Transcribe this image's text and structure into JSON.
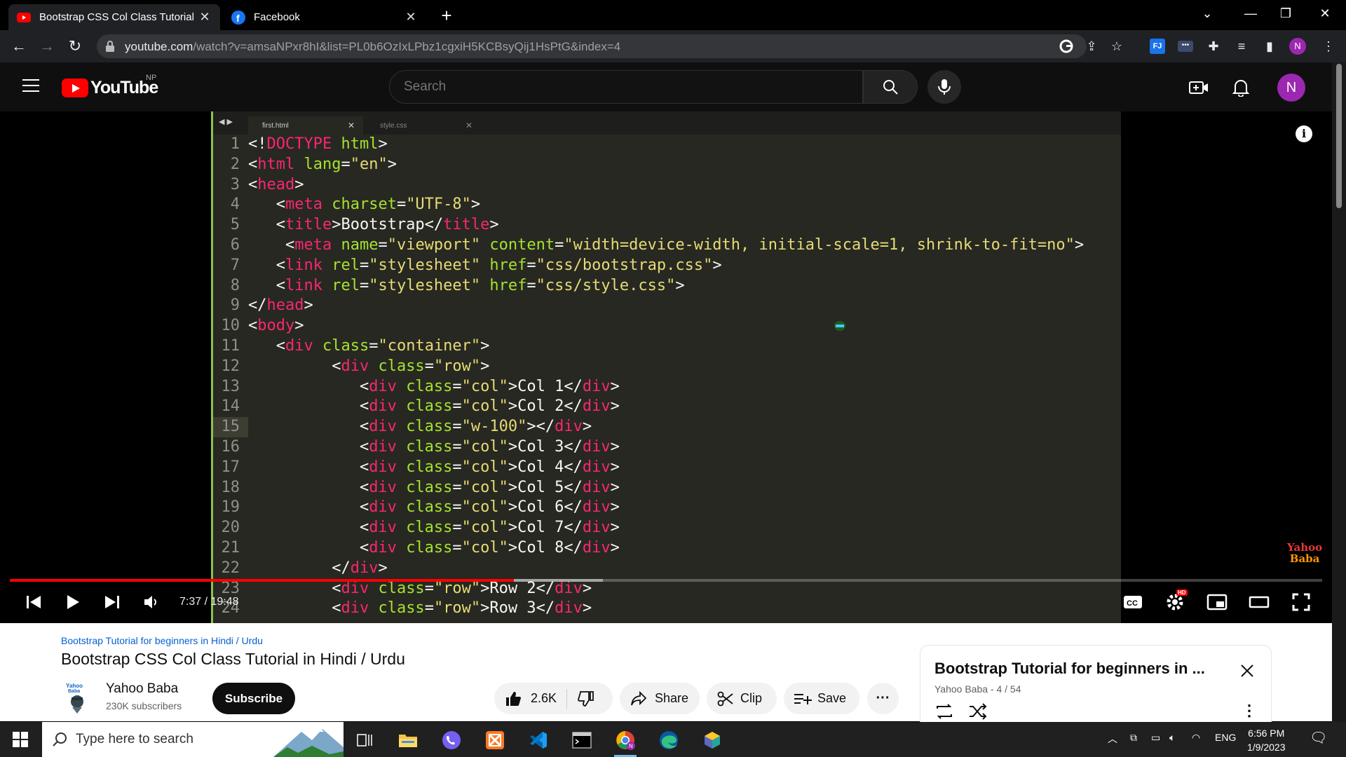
{
  "browser": {
    "tabs": [
      {
        "title": "Bootstrap CSS Col Class Tutorial i",
        "icon": "youtube-icon",
        "active": true
      },
      {
        "title": "Facebook",
        "icon": "facebook-icon",
        "active": false
      }
    ],
    "new_tab": "+",
    "url_host": "youtube.com",
    "url_path": "/watch?v=amsaNPxr8hI&list=PL0b6OzIxLPbz1cgxiH5KCBsyQij1HsPtG&index=4",
    "profile_initial": "N",
    "extension_label": "FJ"
  },
  "youtube": {
    "logo_text": "YouTube",
    "country_code": "NP",
    "search_placeholder": "Search",
    "avatar_initial": "N"
  },
  "editor": {
    "tabs": [
      "first.html",
      "style.css"
    ],
    "current_line": 15,
    "lines": [
      {
        "n": "1",
        "tokens": [
          [
            "p",
            "<!"
          ],
          [
            "t",
            "DOCTYPE"
          ],
          [
            "p",
            " "
          ],
          [
            "a",
            "html"
          ],
          [
            "p",
            ">"
          ]
        ]
      },
      {
        "n": "2",
        "tokens": [
          [
            "p",
            "<"
          ],
          [
            "t",
            "html"
          ],
          [
            "p",
            " "
          ],
          [
            "a",
            "lang"
          ],
          [
            "p",
            "="
          ],
          [
            "s",
            "\"en\""
          ],
          [
            "p",
            ">"
          ]
        ]
      },
      {
        "n": "3",
        "tokens": [
          [
            "p",
            "<"
          ],
          [
            "t",
            "head"
          ],
          [
            "p",
            ">"
          ]
        ]
      },
      {
        "n": "4",
        "tokens": [
          [
            "p",
            "   <"
          ],
          [
            "t",
            "meta"
          ],
          [
            "p",
            " "
          ],
          [
            "a",
            "charset"
          ],
          [
            "p",
            "="
          ],
          [
            "s",
            "\"UTF-8\""
          ],
          [
            "p",
            ">"
          ]
        ]
      },
      {
        "n": "5",
        "tokens": [
          [
            "p",
            "   <"
          ],
          [
            "t",
            "title"
          ],
          [
            "p",
            ">Bootstrap</"
          ],
          [
            "t",
            "title"
          ],
          [
            "p",
            ">"
          ]
        ]
      },
      {
        "n": "6",
        "tokens": [
          [
            "p",
            "    <"
          ],
          [
            "t",
            "meta"
          ],
          [
            "p",
            " "
          ],
          [
            "a",
            "name"
          ],
          [
            "p",
            "="
          ],
          [
            "s",
            "\"viewport\""
          ],
          [
            "p",
            " "
          ],
          [
            "a",
            "content"
          ],
          [
            "p",
            "="
          ],
          [
            "s",
            "\"width=device-width, initial-scale=1, shrink-to-fit=no\""
          ],
          [
            "p",
            ">"
          ]
        ]
      },
      {
        "n": "7",
        "tokens": [
          [
            "p",
            "   <"
          ],
          [
            "t",
            "link"
          ],
          [
            "p",
            " "
          ],
          [
            "a",
            "rel"
          ],
          [
            "p",
            "="
          ],
          [
            "s",
            "\"stylesheet\""
          ],
          [
            "p",
            " "
          ],
          [
            "a",
            "href"
          ],
          [
            "p",
            "="
          ],
          [
            "s",
            "\"css/bootstrap.css\""
          ],
          [
            "p",
            ">"
          ]
        ]
      },
      {
        "n": "8",
        "tokens": [
          [
            "p",
            "   <"
          ],
          [
            "t",
            "link"
          ],
          [
            "p",
            " "
          ],
          [
            "a",
            "rel"
          ],
          [
            "p",
            "="
          ],
          [
            "s",
            "\"stylesheet\""
          ],
          [
            "p",
            " "
          ],
          [
            "a",
            "href"
          ],
          [
            "p",
            "="
          ],
          [
            "s",
            "\"css/style.css\""
          ],
          [
            "p",
            ">"
          ]
        ]
      },
      {
        "n": "9",
        "tokens": [
          [
            "p",
            "</"
          ],
          [
            "t",
            "head"
          ],
          [
            "p",
            ">"
          ]
        ]
      },
      {
        "n": "10",
        "tokens": [
          [
            "p",
            "<"
          ],
          [
            "t",
            "body"
          ],
          [
            "p",
            ">"
          ]
        ]
      },
      {
        "n": "11",
        "tokens": [
          [
            "p",
            "   <"
          ],
          [
            "t",
            "div"
          ],
          [
            "p",
            " "
          ],
          [
            "a",
            "class"
          ],
          [
            "p",
            "="
          ],
          [
            "s",
            "\"container\""
          ],
          [
            "p",
            ">"
          ]
        ]
      },
      {
        "n": "12",
        "tokens": [
          [
            "p",
            "         <"
          ],
          [
            "t",
            "div"
          ],
          [
            "p",
            " "
          ],
          [
            "a",
            "class"
          ],
          [
            "p",
            "="
          ],
          [
            "s",
            "\"row\""
          ],
          [
            "p",
            ">"
          ]
        ]
      },
      {
        "n": "13",
        "tokens": [
          [
            "p",
            "            <"
          ],
          [
            "t",
            "div"
          ],
          [
            "p",
            " "
          ],
          [
            "a",
            "class"
          ],
          [
            "p",
            "="
          ],
          [
            "s",
            "\"col\""
          ],
          [
            "p",
            ">Col 1</"
          ],
          [
            "t",
            "div"
          ],
          [
            "p",
            ">"
          ]
        ]
      },
      {
        "n": "14",
        "tokens": [
          [
            "p",
            "            <"
          ],
          [
            "t",
            "div"
          ],
          [
            "p",
            " "
          ],
          [
            "a",
            "class"
          ],
          [
            "p",
            "="
          ],
          [
            "s",
            "\"col\""
          ],
          [
            "p",
            ">Col 2</"
          ],
          [
            "t",
            "div"
          ],
          [
            "p",
            ">"
          ]
        ]
      },
      {
        "n": "15",
        "tokens": [
          [
            "p",
            "            <"
          ],
          [
            "t",
            "div"
          ],
          [
            "p",
            " "
          ],
          [
            "a",
            "class"
          ],
          [
            "p",
            "="
          ],
          [
            "s",
            "\"w-100\""
          ],
          [
            "p",
            "></"
          ],
          [
            "t",
            "div"
          ],
          [
            "p",
            ">"
          ]
        ]
      },
      {
        "n": "16",
        "tokens": [
          [
            "p",
            "            <"
          ],
          [
            "t",
            "div"
          ],
          [
            "p",
            " "
          ],
          [
            "a",
            "class"
          ],
          [
            "p",
            "="
          ],
          [
            "s",
            "\"col\""
          ],
          [
            "p",
            ">Col 3</"
          ],
          [
            "t",
            "div"
          ],
          [
            "p",
            ">"
          ]
        ]
      },
      {
        "n": "17",
        "tokens": [
          [
            "p",
            "            <"
          ],
          [
            "t",
            "div"
          ],
          [
            "p",
            " "
          ],
          [
            "a",
            "class"
          ],
          [
            "p",
            "="
          ],
          [
            "s",
            "\"col\""
          ],
          [
            "p",
            ">Col 4</"
          ],
          [
            "t",
            "div"
          ],
          [
            "p",
            ">"
          ]
        ]
      },
      {
        "n": "18",
        "tokens": [
          [
            "p",
            "            <"
          ],
          [
            "t",
            "div"
          ],
          [
            "p",
            " "
          ],
          [
            "a",
            "class"
          ],
          [
            "p",
            "="
          ],
          [
            "s",
            "\"col\""
          ],
          [
            "p",
            ">Col 5</"
          ],
          [
            "t",
            "div"
          ],
          [
            "p",
            ">"
          ]
        ]
      },
      {
        "n": "19",
        "tokens": [
          [
            "p",
            "            <"
          ],
          [
            "t",
            "div"
          ],
          [
            "p",
            " "
          ],
          [
            "a",
            "class"
          ],
          [
            "p",
            "="
          ],
          [
            "s",
            "\"col\""
          ],
          [
            "p",
            ">Col 6</"
          ],
          [
            "t",
            "div"
          ],
          [
            "p",
            ">"
          ]
        ]
      },
      {
        "n": "20",
        "tokens": [
          [
            "p",
            "            <"
          ],
          [
            "t",
            "div"
          ],
          [
            "p",
            " "
          ],
          [
            "a",
            "class"
          ],
          [
            "p",
            "="
          ],
          [
            "s",
            "\"col\""
          ],
          [
            "p",
            ">Col 7</"
          ],
          [
            "t",
            "div"
          ],
          [
            "p",
            ">"
          ]
        ]
      },
      {
        "n": "21",
        "tokens": [
          [
            "p",
            "            <"
          ],
          [
            "t",
            "div"
          ],
          [
            "p",
            " "
          ],
          [
            "a",
            "class"
          ],
          [
            "p",
            "="
          ],
          [
            "s",
            "\"col\""
          ],
          [
            "p",
            ">Col 8</"
          ],
          [
            "t",
            "div"
          ],
          [
            "p",
            ">"
          ]
        ]
      },
      {
        "n": "22",
        "tokens": [
          [
            "p",
            "         </"
          ],
          [
            "t",
            "div"
          ],
          [
            "p",
            ">"
          ]
        ]
      },
      {
        "n": "23",
        "tokens": [
          [
            "p",
            "         <"
          ],
          [
            "t",
            "div"
          ],
          [
            "p",
            " "
          ],
          [
            "a",
            "class"
          ],
          [
            "p",
            "="
          ],
          [
            "s",
            "\"row\""
          ],
          [
            "p",
            ">Row 2</"
          ],
          [
            "t",
            "div"
          ],
          [
            "p",
            ">"
          ]
        ]
      },
      {
        "n": "24",
        "tokens": [
          [
            "p",
            "         <"
          ],
          [
            "t",
            "div"
          ],
          [
            "p",
            " "
          ],
          [
            "a",
            "class"
          ],
          [
            "p",
            "="
          ],
          [
            "s",
            "\"row\""
          ],
          [
            "p",
            ">Row 3</"
          ],
          [
            "t",
            "div"
          ],
          [
            "p",
            ">"
          ]
        ]
      }
    ],
    "watermark_line1": "Yahoo",
    "watermark_line2": "Baba"
  },
  "player": {
    "time": "7:37 / 19:48",
    "progress_fraction": 0.384,
    "buffered_fraction": 0.452,
    "hd_badge": "HD",
    "colors": {
      "progress": "#ff0000"
    }
  },
  "video": {
    "playlist_link": "Bootstrap Tutorial for beginners in Hindi / Urdu",
    "title": "Bootstrap CSS Col Class Tutorial in Hindi / Urdu",
    "channel": "Yahoo Baba",
    "subscribers": "230K subscribers",
    "subscribe_label": "Subscribe",
    "likes": "2.6K",
    "share_label": "Share",
    "clip_label": "Clip",
    "save_label": "Save"
  },
  "playlist_panel": {
    "title": "Bootstrap Tutorial for beginners in ...",
    "subtitle": "Yahoo Baba - 4 / 54"
  },
  "taskbar": {
    "search_placeholder": "Type here to search",
    "language": "ENG",
    "time": "6:56 PM",
    "date": "1/9/2023"
  }
}
